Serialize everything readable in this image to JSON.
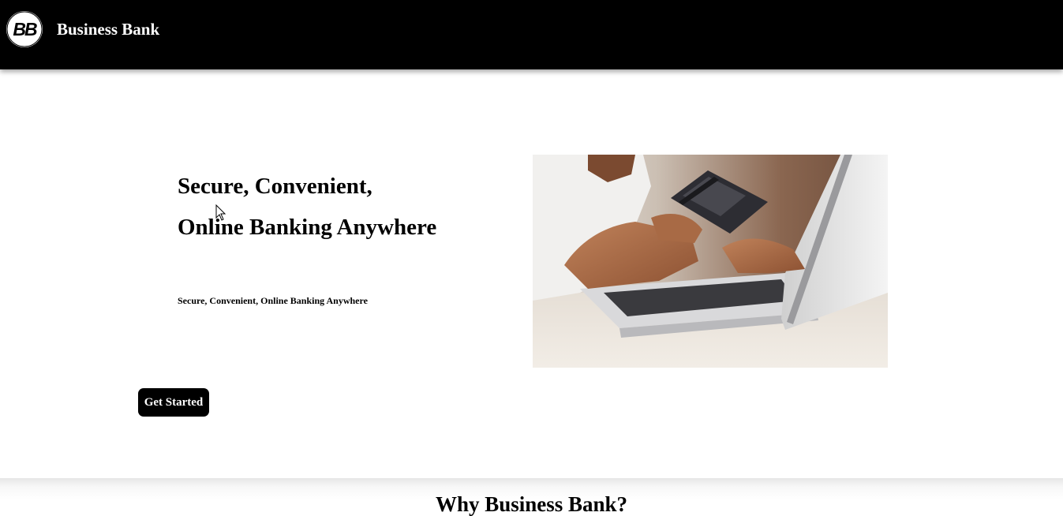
{
  "header": {
    "logo_text": "BB",
    "brand_name": "Business Bank"
  },
  "hero": {
    "title_line1": "Secure, Convenient,",
    "title_line2": "Online Banking Anywhere",
    "subtitle": "Secure, Convenient, Online Banking Anywhere",
    "cta_label": "Get Started",
    "image_alt": "Person holding a credit card while typing on a laptop"
  },
  "next_section": {
    "heading": "Why Business Bank?"
  },
  "colors": {
    "header_bg": "#000000",
    "page_bg": "#ffffff",
    "button_bg": "#000000",
    "button_text": "#ffffff"
  }
}
